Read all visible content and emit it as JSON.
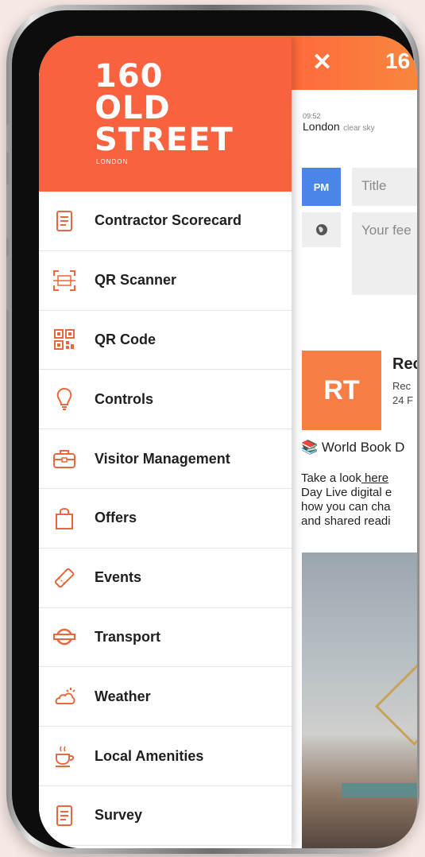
{
  "app": {
    "logo_lines": [
      "160",
      "OLD",
      "STREET"
    ],
    "logo_sub": "LONDON",
    "topbar_title": "16"
  },
  "menu": [
    {
      "label": "Contractor Scorecard",
      "icon": "scorecard-icon"
    },
    {
      "label": "QR Scanner",
      "icon": "qr-scanner-icon"
    },
    {
      "label": "QR Code",
      "icon": "qr-code-icon"
    },
    {
      "label": "Controls",
      "icon": "lightbulb-icon"
    },
    {
      "label": "Visitor Management",
      "icon": "briefcase-icon"
    },
    {
      "label": "Offers",
      "icon": "shopping-bag-icon"
    },
    {
      "label": "Events",
      "icon": "ticket-icon"
    },
    {
      "label": "Transport",
      "icon": "underground-icon"
    },
    {
      "label": "Weather",
      "icon": "weather-icon"
    },
    {
      "label": "Local Amenities",
      "icon": "coffee-icon"
    },
    {
      "label": "Survey",
      "icon": "survey-icon"
    }
  ],
  "feed": {
    "time": "09:52",
    "city": "London",
    "condition": "clear sky",
    "pm_label": "PM",
    "title_placeholder": "Title",
    "feed_placeholder": "Your fee",
    "avatar_initials": "RT",
    "post_title": "Rec",
    "post_meta_1": "Rec",
    "post_meta_2": "24 F",
    "post_heading": "World Book D",
    "post_body_1": "Take a look",
    "post_link": " here",
    "post_body_2": "Day Live digital e",
    "post_body_3": "how you can cha",
    "post_body_4": "and shared readi"
  },
  "colors": {
    "brand": "#f9623f",
    "accent_blue": "#4a86e8",
    "avatar_orange": "#f57e44",
    "icon_orange": "#e8673f"
  }
}
